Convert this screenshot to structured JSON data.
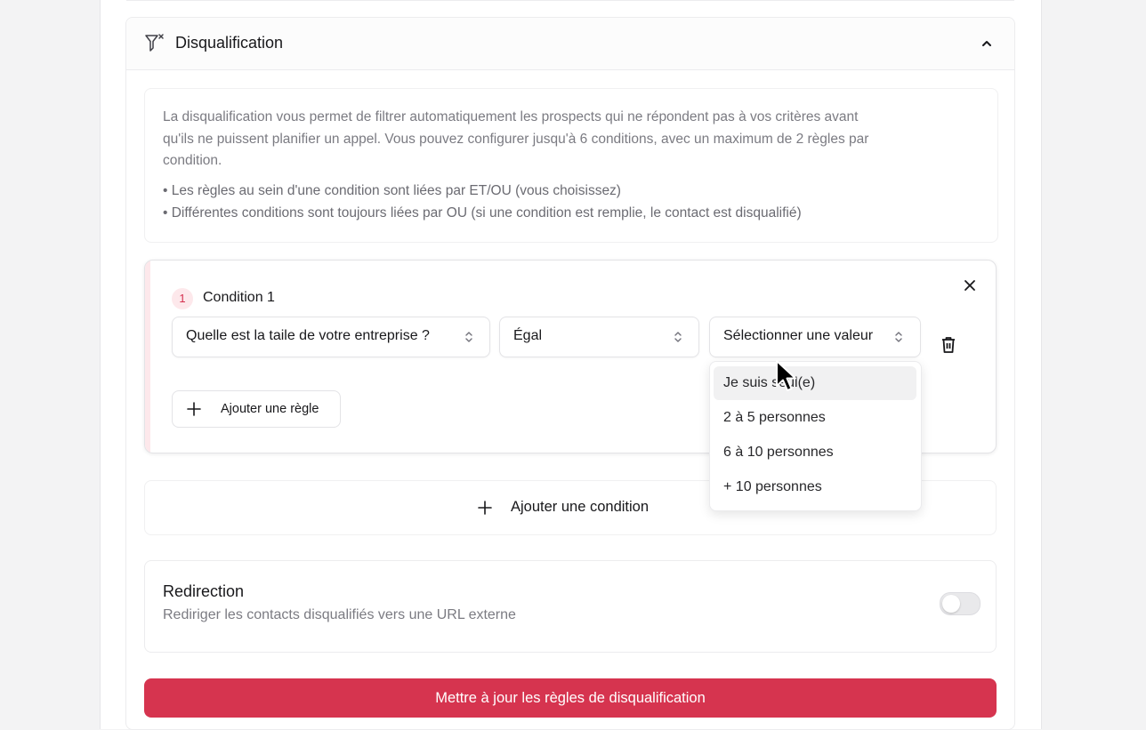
{
  "section": {
    "title": "Disqualification",
    "icons": {
      "filter": "filter-x-icon",
      "collapse": "chevron-up-icon"
    }
  },
  "info": {
    "paragraph_lines": [
      "La disqualification vous permet de filtrer automatiquement les prospects qui ne répondent pas à vos critères avant",
      "qu'ils ne puissent planifier un appel. Vous pouvez configurer jusqu'à 6 conditions, avec un maximum de 2 règles par",
      "condition."
    ],
    "bullets": [
      "• Les règles au sein d'une condition sont liées par ET/OU (vous choisissez)",
      "• Différentes conditions sont toujours liées par OU (si une condition est remplie, le contact est disqualifié)"
    ]
  },
  "condition": {
    "number": "1",
    "title": "Condition 1",
    "question_select": "Quelle est la taile de votre entreprise ?",
    "operator_select": "Égal",
    "value_select_placeholder": "Sélectionner une valeur",
    "add_rule_label": "Ajouter une règle"
  },
  "dropdown": {
    "options": [
      "Je suis seul(e)",
      "2 à 5 personnes",
      "6 à 10 personnes",
      "+ 10 personnes"
    ],
    "highlighted_index": 0
  },
  "add_condition_label": "Ajouter une condition",
  "redirection": {
    "title": "Redirection",
    "description": "Rediriger les contacts disqualifiés vers une URL externe",
    "enabled": false
  },
  "submit_label": "Mettre à jour les règles de disqualification",
  "colors": {
    "accent": "#d6344f",
    "badge_bg": "#fde8eb",
    "muted_text": "#7b7b82"
  }
}
